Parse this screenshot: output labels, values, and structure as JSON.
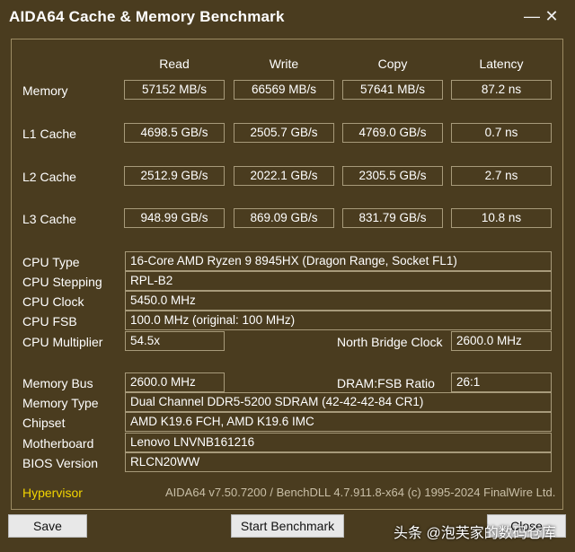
{
  "window": {
    "title": "AIDA64 Cache & Memory Benchmark",
    "minimize_glyph": "—",
    "close_glyph": "✕"
  },
  "columns": [
    "Read",
    "Write",
    "Copy",
    "Latency"
  ],
  "bench_rows": [
    {
      "label": "Memory",
      "values": [
        "57152 MB/s",
        "66569 MB/s",
        "57641 MB/s",
        "87.2 ns"
      ]
    },
    {
      "label": "L1 Cache",
      "values": [
        "4698.5 GB/s",
        "2505.7 GB/s",
        "4769.0 GB/s",
        "0.7 ns"
      ]
    },
    {
      "label": "L2 Cache",
      "values": [
        "2512.9 GB/s",
        "2022.1 GB/s",
        "2305.5 GB/s",
        "2.7 ns"
      ]
    },
    {
      "label": "L3 Cache",
      "values": [
        "948.99 GB/s",
        "869.09 GB/s",
        "831.79 GB/s",
        "10.8 ns"
      ]
    }
  ],
  "cpu": {
    "type_label": "CPU Type",
    "type": "16-Core AMD Ryzen 9 8945HX  (Dragon Range, Socket FL1)",
    "stepping_label": "CPU Stepping",
    "stepping": "RPL-B2",
    "clock_label": "CPU Clock",
    "clock": "5450.0 MHz",
    "fsb_label": "CPU FSB",
    "fsb": "100.0 MHz  (original: 100 MHz)",
    "multiplier_label": "CPU Multiplier",
    "multiplier": "54.5x",
    "nb_clock_label": "North Bridge Clock",
    "nb_clock": "2600.0 MHz"
  },
  "memory": {
    "bus_label": "Memory Bus",
    "bus": "2600.0 MHz",
    "ratio_label": "DRAM:FSB Ratio",
    "ratio": "26:1",
    "type_label": "Memory Type",
    "type": "Dual Channel DDR5-5200 SDRAM  (42-42-42-84 CR1)",
    "chipset_label": "Chipset",
    "chipset": "AMD K19.6 FCH, AMD K19.6 IMC",
    "motherboard_label": "Motherboard",
    "motherboard": "Lenovo LNVNB161216",
    "bios_label": "BIOS Version",
    "bios": "RLCN20WW"
  },
  "footer": {
    "hypervisor": "Hypervisor",
    "version": "AIDA64 v7.50.7200 / BenchDLL 4.7.911.8-x64  (c) 1995-2024 FinalWire Ltd."
  },
  "buttons": {
    "save": "Save",
    "start": "Start Benchmark",
    "close": "Close"
  },
  "watermark": "头条 @泡芙家的数码仓库"
}
